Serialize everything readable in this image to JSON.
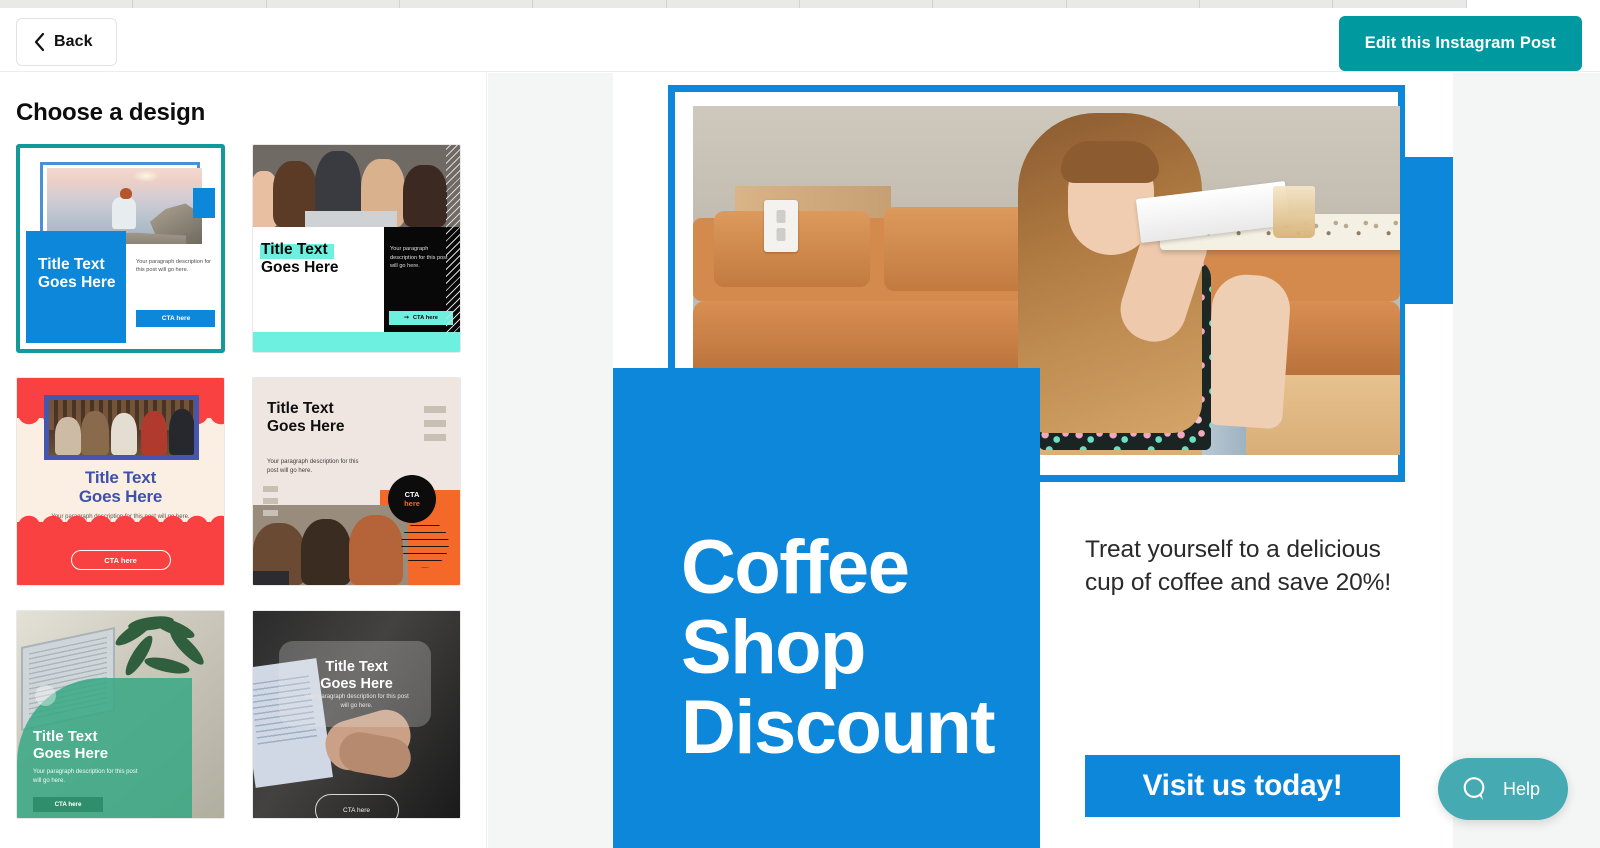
{
  "browser": {
    "tab_count": 12,
    "active_tab_index": 11
  },
  "header": {
    "back_label": "Back",
    "back_icon": "chevron-left-icon",
    "edit_button_label": "Edit this Instagram Post",
    "edit_button_color": "#0099a0"
  },
  "design_panel": {
    "title": "Choose a design",
    "selected_index": 0,
    "selection_color": "#129a9a",
    "designs": [
      {
        "id": "design-blue-frame",
        "name": "Blue frame layout",
        "title": "Title Text\nGoes Here",
        "title_line1": "Title Text",
        "title_line2": "Goes Here",
        "paragraph": "Your paragraph description for this post will go here.",
        "cta": "CTA here",
        "accent": "#0d87d9",
        "selected": true
      },
      {
        "id": "design-black-mint",
        "name": "Black and mint layout",
        "title_line1": "Title Text",
        "title_line2": "Goes Here",
        "paragraph": "Your paragraph description for this post will go here.",
        "cta": "CTA here",
        "accent": "#6ef0e0",
        "selected": false
      },
      {
        "id": "design-red-wave",
        "name": "Red wave layout",
        "title_line1": "Title Text",
        "title_line2": "Goes Here",
        "paragraph": "Your paragraph description for this post will go here.",
        "cta": "CTA here",
        "accent": "#f94141",
        "selected": false
      },
      {
        "id": "design-cream-orange",
        "name": "Cream and orange layout",
        "title_line1": "Title Text",
        "title_line2": "Goes Here",
        "paragraph": "Your paragraph description for this post will go here.",
        "cta_line1": "CTA",
        "cta_line2": "here",
        "accent": "#f4682a",
        "selected": false
      },
      {
        "id": "design-green-overlay",
        "name": "Green overlay layout",
        "title_line1": "Title Text",
        "title_line2": "Goes Here",
        "paragraph": "Your paragraph description for this post will go here.",
        "cta": "CTA here",
        "accent": "#38a884",
        "selected": false
      },
      {
        "id": "design-dark-glass",
        "name": "Dark glass layout",
        "title_line1": "Title Text",
        "title_line2": "Goes Here",
        "paragraph": "Your paragraph description for this post will go here.",
        "cta": "CTA here",
        "accent": "#1a1a1a",
        "selected": false
      }
    ]
  },
  "preview": {
    "heading_line1": "Coffee",
    "heading_line2": "Shop",
    "heading_line3": "Discount",
    "caption": "Treat yourself to a delicious cup of coffee and save 20%!",
    "cta_label": "Visit us today!",
    "accent_color": "#0c87d9",
    "photo_alt": "Woman in floral dress reading a book on a leather couch in a cafe"
  },
  "help": {
    "label": "Help",
    "icon": "chat-bubble-icon",
    "color": "#46aab3"
  }
}
